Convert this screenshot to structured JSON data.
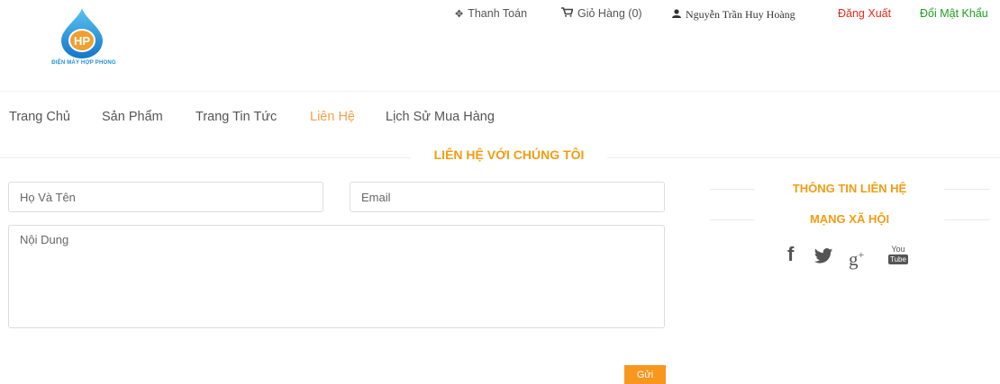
{
  "logo": {
    "brand_text": "ĐIỆN MÁY HỢP PHONG",
    "initials": "HP"
  },
  "top_links": {
    "payment": "Thanh Toán",
    "cart": "Giỏ Hàng (0)",
    "user": "Nguyễn Trần Huy Hoàng",
    "logout": "Đăng Xuất",
    "change_password": "Đổi Mật Khẩu"
  },
  "nav": {
    "items": [
      {
        "label": "Trang Chủ"
      },
      {
        "label": "Sản Phẩm"
      },
      {
        "label": "Trang Tin Tức"
      },
      {
        "label": "Liên Hệ",
        "active": true
      },
      {
        "label": "Lịch Sử Mua Hàng"
      }
    ]
  },
  "contact_form": {
    "title": "LIÊN HỆ VỚI CHÚNG TÔI",
    "name_placeholder": "Họ Và Tên",
    "email_placeholder": "Email",
    "content_placeholder": "Nội Dung",
    "submit_label": "Gửi"
  },
  "sidebar": {
    "contact_info_title": "THÔNG TIN LIÊN HỆ",
    "social_title": "MẠNG XÃ HỘI",
    "social_icons": [
      "facebook-icon",
      "twitter-icon",
      "google-plus-icon",
      "youtube-icon"
    ],
    "youtube_text_top": "You",
    "youtube_text_bottom": "Tube"
  },
  "colors": {
    "accent": "#f39c12",
    "button": "#f7971e",
    "logout": "#e32b1e",
    "change_password": "#1ea01e",
    "logo_blue": "#1f8fd8"
  }
}
